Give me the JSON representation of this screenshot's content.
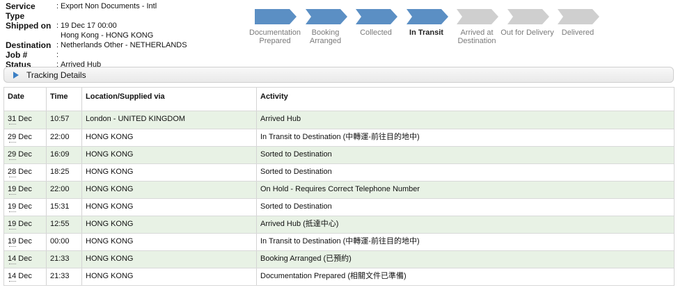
{
  "shipment": {
    "service_type_label": "Service Type",
    "service_type": "Export Non Documents - Intl",
    "shipped_on_label": "Shipped on",
    "shipped_on_date": "19 Dec 17 00:00",
    "shipped_on_place": "Hong Kong - HONG KONG",
    "destination_label": "Destination",
    "destination": "Netherlands Other - NETHERLANDS",
    "job_label": "Job #",
    "job": "",
    "status_label": "Status",
    "status": "Arrived Hub",
    "colon": ":"
  },
  "progress": {
    "steps": [
      {
        "label": "Documentation Prepared",
        "line1": "Documentation",
        "line2": "Prepared",
        "state": "done"
      },
      {
        "label": "Booking Arranged",
        "line1": "Booking",
        "line2": "Arranged",
        "state": "done"
      },
      {
        "label": "Collected",
        "line1": "Collected",
        "line2": "",
        "state": "done"
      },
      {
        "label": "In Transit",
        "line1": "In Transit",
        "line2": "",
        "state": "current"
      },
      {
        "label": "Arrived at Destination",
        "line1": "Arrived at",
        "line2": "Destination",
        "state": "pending"
      },
      {
        "label": "Out for Delivery",
        "line1": "Out for Delivery",
        "line2": "",
        "state": "pending"
      },
      {
        "label": "Delivered",
        "line1": "Delivered",
        "line2": "",
        "state": "pending"
      }
    ],
    "colors": {
      "done": "#5b8fc4",
      "current": "#5b8fc4",
      "pending": "#cfcfcf"
    }
  },
  "tracking": {
    "title": "Tracking Details",
    "icon": "expand-triangle-icon",
    "columns": [
      "Date",
      "Time",
      "Location/Supplied via",
      "Activity"
    ],
    "rows": [
      {
        "date": "31 Dec",
        "time": "10:57",
        "location": "London - UNITED KINGDOM",
        "activity": "Arrived Hub"
      },
      {
        "date": "29 Dec",
        "time": "22:00",
        "location": "HONG KONG",
        "activity": "In Transit to Destination (中轉運-前往目的地中)"
      },
      {
        "date": "29 Dec",
        "time": "16:09",
        "location": "HONG KONG",
        "activity": "Sorted to Destination"
      },
      {
        "date": "28 Dec",
        "time": "18:25",
        "location": "HONG KONG",
        "activity": "Sorted to Destination"
      },
      {
        "date": "19 Dec",
        "time": "22:00",
        "location": "HONG KONG",
        "activity": "On Hold - Requires Correct Telephone Number"
      },
      {
        "date": "19 Dec",
        "time": "15:31",
        "location": "HONG KONG",
        "activity": "Sorted to Destination"
      },
      {
        "date": "19 Dec",
        "time": "12:55",
        "location": "HONG KONG",
        "activity": "Arrived Hub (抵達中心)"
      },
      {
        "date": "19 Dec",
        "time": "00:00",
        "location": "HONG KONG",
        "activity": "In Transit to Destination (中轉運-前往目的地中)"
      },
      {
        "date": "14 Dec",
        "time": "21:33",
        "location": "HONG KONG",
        "activity": "Booking Arranged (已預約)"
      },
      {
        "date": "14 Dec",
        "time": "21:33",
        "location": "HONG KONG",
        "activity": "Documentation Prepared (相關文件已準備)"
      }
    ],
    "colors": {
      "row_alt": "#e8f2e5"
    }
  }
}
